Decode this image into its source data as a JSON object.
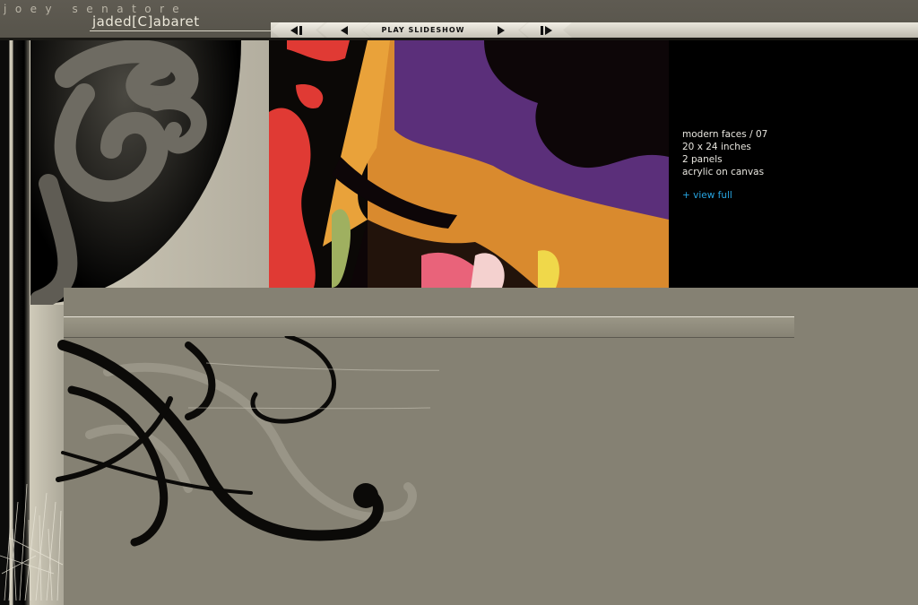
{
  "brand": {
    "artist": "joey senatore",
    "site": "jaded[C]abaret"
  },
  "toolbar": {
    "first_icon": "skip-to-first-icon",
    "prev_icon": "previous-icon",
    "play_label": "PLAY SLIDESHOW",
    "next_icon": "next-icon",
    "last_icon": "skip-to-last-icon"
  },
  "artwork": {
    "info": [
      "modern faces / 07",
      "20 x 24 inches",
      "2 panels",
      "acrylic on canvas"
    ],
    "view_full_label": "+ view full"
  },
  "colors": {
    "background": "#858173",
    "link": "#27a4e0",
    "info_text": "#e8e6df",
    "header": "#5a564d"
  }
}
